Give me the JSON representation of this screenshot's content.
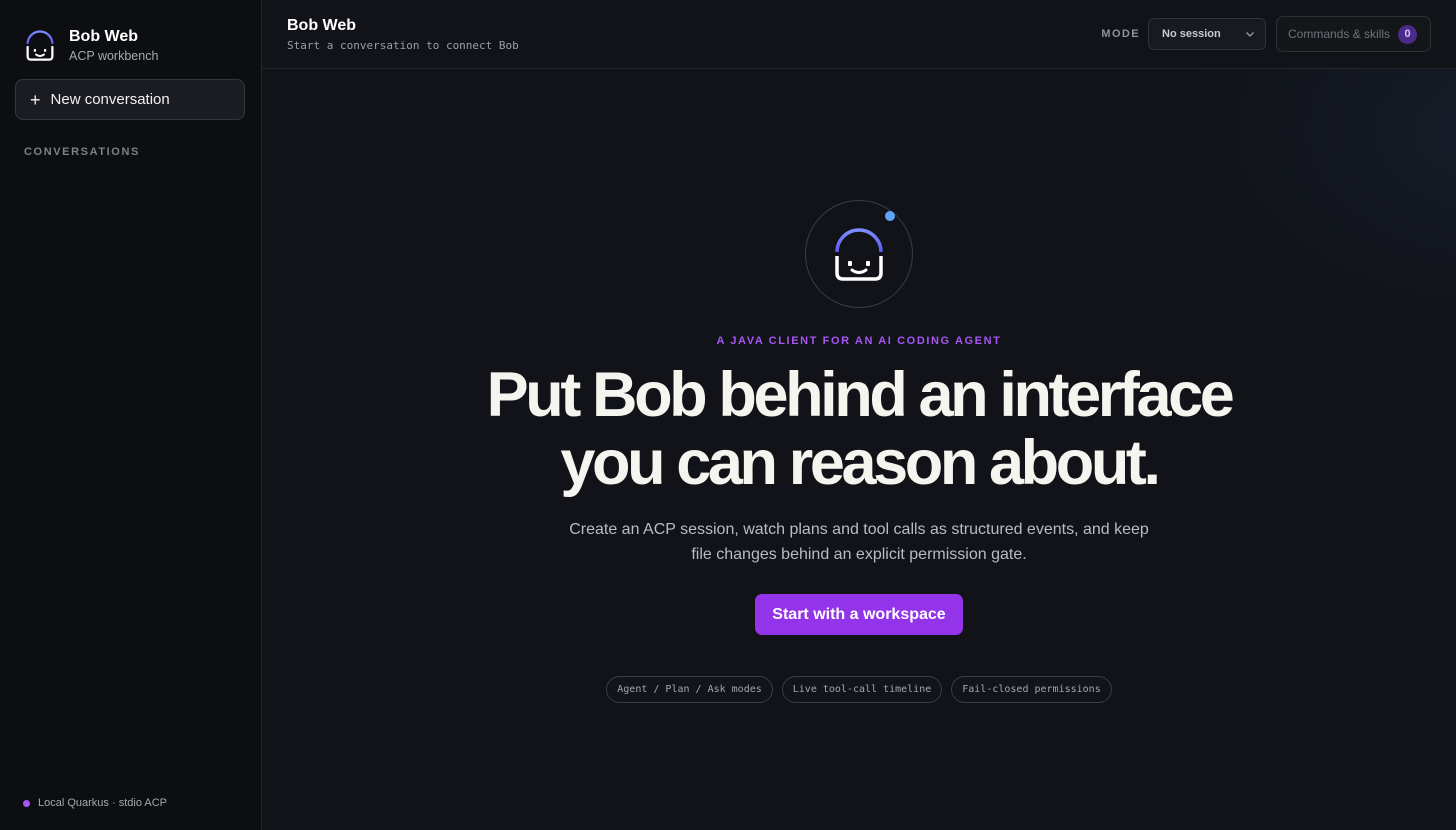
{
  "sidebar": {
    "brand_title": "Bob Web",
    "brand_subtitle": "ACP workbench",
    "new_conversation_label": "New conversation",
    "conversations_heading": "CONVERSATIONS",
    "footer_status": "Local Quarkus · stdio ACP"
  },
  "topbar": {
    "title": "Bob Web",
    "subtitle": "Start a conversation to connect Bob",
    "mode_label": "MODE",
    "mode_selected": "No session",
    "commands_label": "Commands & skills",
    "commands_count": "0"
  },
  "hero": {
    "eyebrow": "A JAVA CLIENT FOR AN AI CODING AGENT",
    "headline_line1": "Put Bob behind an interface",
    "headline_line2": "you can reason about.",
    "description": "Create an ACP session, watch plans and tool calls as structured events, and keep file changes behind an explicit permission gate.",
    "cta_label": "Start with a workspace",
    "chips": [
      "Agent / Plan / Ask modes",
      "Live tool-call timeline",
      "Fail-closed permissions"
    ]
  },
  "colors": {
    "accent": "#9333ea",
    "eyebrow": "#a855f7",
    "status_dot": "#a855f7",
    "online_indicator": "#60a5fa",
    "logo_helmet": "#6366f1"
  },
  "icons": {
    "brand_logo": "bob-helmet-icon",
    "plus": "plus-icon",
    "select_chevron": "chevron-down-icon"
  }
}
